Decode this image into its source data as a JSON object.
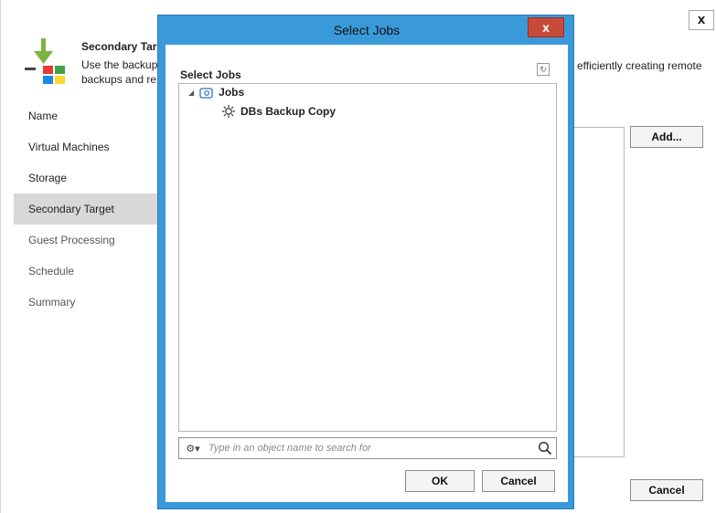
{
  "window": {
    "close_label": "x"
  },
  "header": {
    "title": "Secondary Targ",
    "desc_line1": "Use the backup",
    "desc_line2": "backups and re",
    "desc_right": "efficiently creating remote"
  },
  "nav": {
    "items": [
      {
        "label": "Name"
      },
      {
        "label": "Virtual Machines"
      },
      {
        "label": "Storage"
      },
      {
        "label": "Secondary Target",
        "active": true
      },
      {
        "label": "Guest Processing"
      },
      {
        "label": "Schedule"
      },
      {
        "label": "Summary"
      }
    ]
  },
  "right_panel": {
    "add_label": "Add..."
  },
  "footer": {
    "cancel_label": "Cancel"
  },
  "dialog": {
    "title": "Select Jobs",
    "close_label": "x",
    "section_label": "Select Jobs",
    "tree": {
      "root": "Jobs",
      "children": [
        "DBs Backup Copy"
      ]
    },
    "search": {
      "placeholder": "Type in an object name to search for"
    },
    "ok_label": "OK",
    "cancel_label": "Cancel"
  },
  "colors": {
    "dialog_frame": "#3a9ad9",
    "close_button": "#c74a3b",
    "nav_active": "#d8d8d8"
  }
}
